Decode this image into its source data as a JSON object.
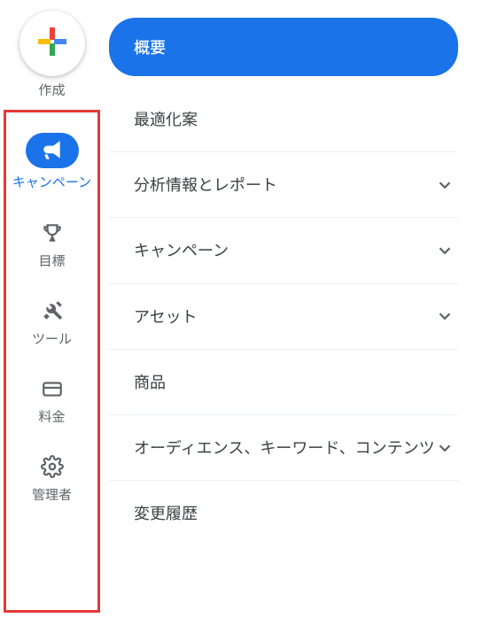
{
  "sidebar": {
    "create_label": "作成",
    "items": [
      {
        "label": "キャンペーン",
        "icon": "megaphone-icon",
        "active": true
      },
      {
        "label": "目標",
        "icon": "trophy-icon",
        "active": false
      },
      {
        "label": "ツール",
        "icon": "tools-icon",
        "active": false
      },
      {
        "label": "料金",
        "icon": "billing-icon",
        "active": false
      },
      {
        "label": "管理者",
        "icon": "gear-icon",
        "active": false
      }
    ]
  },
  "menu": {
    "items": [
      {
        "label": "概要",
        "expandable": false,
        "active": true
      },
      {
        "label": "最適化案",
        "expandable": false,
        "active": false
      },
      {
        "label": "分析情報とレポート",
        "expandable": true,
        "active": false
      },
      {
        "label": "キャンペーン",
        "expandable": true,
        "active": false
      },
      {
        "label": "アセット",
        "expandable": true,
        "active": false
      },
      {
        "label": "商品",
        "expandable": false,
        "active": false
      },
      {
        "label": "オーディエンス、キーワード、コンテンツ",
        "expandable": true,
        "active": false
      },
      {
        "label": "変更履歴",
        "expandable": false,
        "active": false
      }
    ]
  },
  "colors": {
    "accent": "#1a73e8",
    "highlight": "#e53935"
  }
}
